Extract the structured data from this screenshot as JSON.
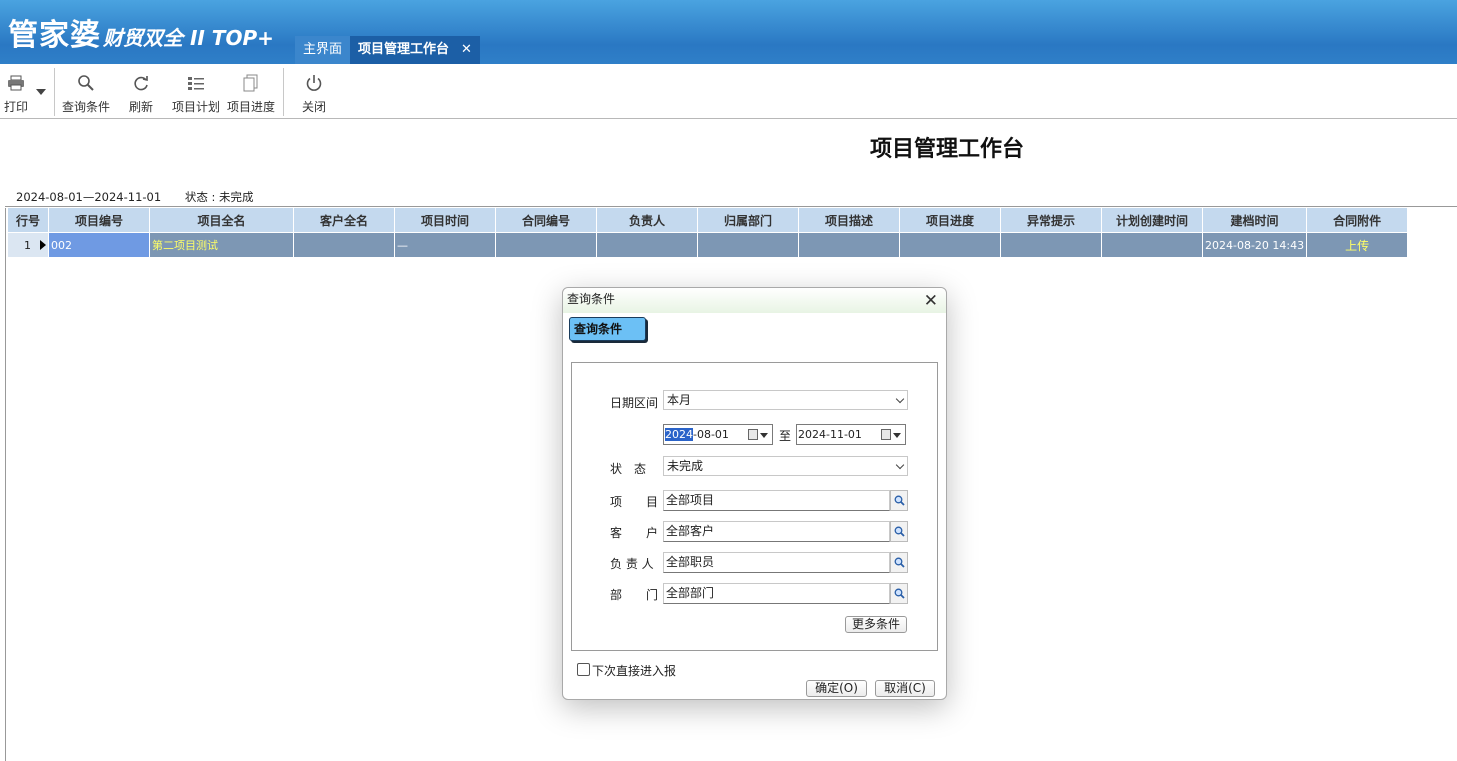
{
  "app": {
    "brand": "管家婆",
    "edition": "财贸双全 II TOP+"
  },
  "tabs": [
    {
      "label": "主界面"
    },
    {
      "label": "项目管理工作台",
      "close": "✕"
    }
  ],
  "toolbar": {
    "print": "打印",
    "query": "查询条件",
    "refresh": "刷新",
    "plan": "项目计划",
    "progress": "项目进度",
    "close": "关闭"
  },
  "page": {
    "title": "项目管理工作台",
    "date_range": "2024-08-01—2024-11-01",
    "status": "状态 : 未完成"
  },
  "table": {
    "columns": [
      "行号",
      "项目编号",
      "项目全名",
      "客户全名",
      "项目时间",
      "合同编号",
      "负责人",
      "归属部门",
      "项目描述",
      "项目进度",
      "异常提示",
      "计划创建时间",
      "建档时间",
      "合同附件"
    ],
    "rows": [
      {
        "rowno": "1",
        "code": "002",
        "name": "第二项目测试",
        "customer": "",
        "time": "—",
        "contract": "",
        "owner": "",
        "dept": "",
        "desc": "",
        "progress": "",
        "warning": "",
        "plan_created": "",
        "created": "2024-08-20 14:43",
        "attachment": "上传"
      }
    ]
  },
  "dialog": {
    "title": "查询条件",
    "close": "✕",
    "tab": "查询条件",
    "date_label": "日期区间",
    "date_mode": "本月",
    "date_from_hl": "2024",
    "date_from_rest": "-08-01",
    "to_label": "至",
    "date_to": "2024-11-01",
    "status_label": "状　态",
    "status_value": "未完成",
    "project_label": "项　　目",
    "project_value": "全部项目",
    "customer_label": "客　　户",
    "customer_value": "全部客户",
    "owner_label": "负 责 人",
    "owner_value": "全部职员",
    "dept_label": "部　　门",
    "dept_value": "全部部门",
    "more": "更多条件",
    "skip_label": "下次直接进入报",
    "ok": "确定(O)",
    "cancel": "取消(C)"
  }
}
